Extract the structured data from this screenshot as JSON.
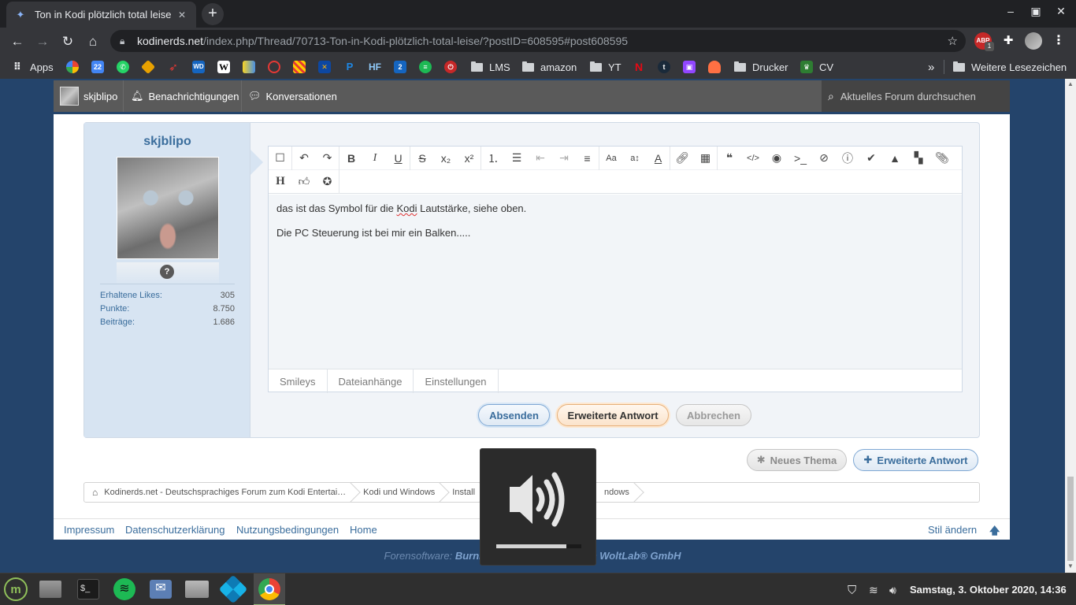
{
  "browser": {
    "tab_title": "Ton in Kodi plötzlich total leise",
    "url_host": "kodinerds.net",
    "url_path": "/index.php/Thread/70713-Ton-in-Kodi-plötzlich-total-leise/?postID=608595#post608595",
    "ext_badge": "ABP",
    "ext_badge_count": "1"
  },
  "bookmarks": {
    "apps": "Apps",
    "calendar_day": "22",
    "wd": "WD",
    "w": "W",
    "hf": "HF",
    "lms": "LMS",
    "amazon": "amazon",
    "yt": "YT",
    "tumblr": "t",
    "drucker": "Drucker",
    "cv": "CV",
    "more": "»",
    "other": "Weitere Lesezeichen"
  },
  "userbar": {
    "username": "skjblipo",
    "notifications": "Benachrichtigungen",
    "conversations": "Konversationen",
    "search_placeholder": "Aktuelles Forum durchsuchen"
  },
  "post": {
    "author": "skjblipo",
    "rank_badge": "?",
    "stats": [
      {
        "label": "Erhaltene Likes:",
        "value": "305"
      },
      {
        "label": "Punkte:",
        "value": "8.750"
      },
      {
        "label": "Beiträge:",
        "value": "1.686"
      }
    ]
  },
  "editor": {
    "toolbar_row2_heading": "H",
    "text_line1_before": "das ist das Symbol für die ",
    "text_line1_spell": "Kodi",
    "text_line1_after": " Lautstärke, siehe oben.",
    "text_line2": "Die PC Steuerung ist bei mir ein Balken.....",
    "tabs": [
      "Smileys",
      "Dateianhänge",
      "Einstellungen"
    ]
  },
  "buttons": {
    "send": "Absenden",
    "extended_reply": "Erweiterte Antwort",
    "cancel": "Abbrechen",
    "new_thread": "Neues Thema",
    "extended_reply2": "Erweiterte Antwort"
  },
  "breadcrumbs": [
    "Kodinerds.net - Deutschsprachiges Forum zum Kodi Entertai…",
    "Kodi und Windows",
    "Install",
    "ndows"
  ],
  "footer": {
    "links": [
      "Impressum",
      "Datenschutzerklärung",
      "Nutzungsbedingungen",
      "Home"
    ],
    "style_change": "Stil ändern",
    "copyright_prefix": "Forensoftware: ",
    "copyright_brand": "Burnin",
    "copyright_suffix": "n WoltLab® GmbH"
  },
  "osd": {
    "volume_level": 0.82
  },
  "taskbar": {
    "clock": "Samstag, 3. Oktober 2020, 14:36"
  },
  "colors": {
    "accent": "#3a6d9c",
    "page_bg": "#24446b",
    "sidebar_bg": "#d7e4f2"
  }
}
